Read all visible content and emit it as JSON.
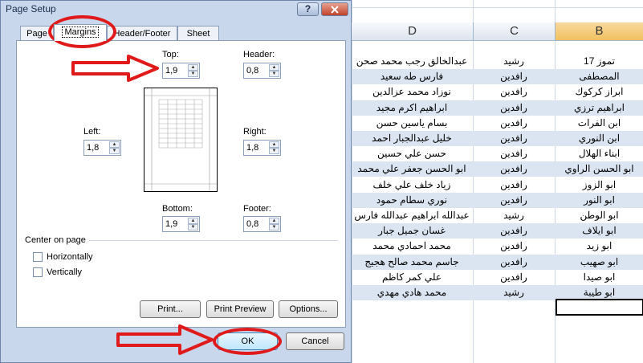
{
  "window": {
    "title": "Page Setup",
    "help_label": "?",
    "close_label": "X"
  },
  "tabs": [
    {
      "label": "Page"
    },
    {
      "label": "Margins",
      "active": true
    },
    {
      "label": "Header/Footer"
    },
    {
      "label": "Sheet"
    }
  ],
  "margins": {
    "top": {
      "label": "Top:",
      "value": "1,9"
    },
    "header": {
      "label": "Header:",
      "value": "0,8"
    },
    "left": {
      "label": "Left:",
      "value": "1,8"
    },
    "right": {
      "label": "Right:",
      "value": "1,8"
    },
    "bottom": {
      "label": "Bottom:",
      "value": "1,9"
    },
    "footer": {
      "label": "Footer:",
      "value": "0,8"
    }
  },
  "center_on_page": {
    "title": "Center on page",
    "horizontally": {
      "label": "Horizontally",
      "checked": false
    },
    "vertically": {
      "label": "Vertically",
      "checked": false
    }
  },
  "buttons": {
    "print": "Print...",
    "print_preview": "Print Preview",
    "options": "Options...",
    "ok": "OK",
    "cancel": "Cancel"
  },
  "spreadsheet": {
    "columns": [
      {
        "label": "D"
      },
      {
        "label": "C"
      },
      {
        "label": "B",
        "selected": true
      }
    ],
    "rows": [
      {
        "d": "عبدالخالق رجب محمد صحن",
        "c": "رشيد",
        "b": "تموز 17"
      },
      {
        "d": "فارس طه سعيد",
        "c": "رافدين",
        "b": "المصطفى"
      },
      {
        "d": "نوزاد محمد عزالدين",
        "c": "رافدين",
        "b": "ابراز كركوك"
      },
      {
        "d": "ابراهيم اكرم مجيد",
        "c": "رافدين",
        "b": "ابراهيم ترزي"
      },
      {
        "d": "بسام ياسين حسن",
        "c": "رافدين",
        "b": "ابن الفرات"
      },
      {
        "d": "خليل عبدالجبار احمد",
        "c": "رافدين",
        "b": "ابن النوري"
      },
      {
        "d": "حسن علي حسين",
        "c": "رافدين",
        "b": "ابناء الهلال"
      },
      {
        "d": "ابو الحسن جعفر علي محمد",
        "c": "رافدين",
        "b": "ابو الحسن الراوي"
      },
      {
        "d": "زياد خلف علي خلف",
        "c": "رافدين",
        "b": "ابو الزوز"
      },
      {
        "d": "نوري سطام حمود",
        "c": "رافدين",
        "b": "ابو النور"
      },
      {
        "d": "عبدالله ابراهيم عبدالله فارس",
        "c": "رشيد",
        "b": "ابو الوطن"
      },
      {
        "d": "غسان جميل جبار",
        "c": "رافدين",
        "b": "ابو ايلاف"
      },
      {
        "d": "محمد احمادي محمد",
        "c": "رافدين",
        "b": "ابو زيد"
      },
      {
        "d": "جاسم محمد صالح هجيج",
        "c": "رافدين",
        "b": "ابو صهيب"
      },
      {
        "d": "علي كمر كاظم",
        "c": "رافدين",
        "b": "ابو صيدا"
      },
      {
        "d": "محمد هادي مهدي",
        "c": "رشيد",
        "b": "ابو طيبة"
      }
    ]
  },
  "annotation_color": "#e0191a"
}
